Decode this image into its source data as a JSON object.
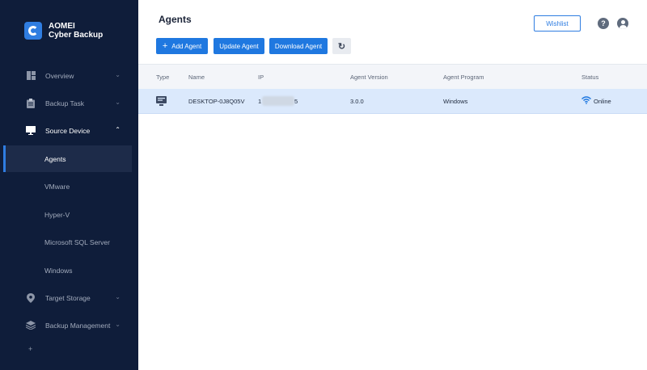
{
  "app": {
    "name_line1": "AOMEI",
    "name_line2": "Cyber Backup"
  },
  "sidebar": {
    "items": [
      {
        "label": "Overview",
        "icon": "overview-icon"
      },
      {
        "label": "Backup Task",
        "icon": "clipboard-icon"
      },
      {
        "label": "Source Device",
        "icon": "monitor-icon"
      },
      {
        "label": "Target Storage",
        "icon": "location-pin-icon"
      },
      {
        "label": "Backup Management",
        "icon": "layers-icon"
      }
    ],
    "sub_items": [
      {
        "label": "Agents"
      },
      {
        "label": "VMware"
      },
      {
        "label": "Hyper-V"
      },
      {
        "label": "Microsoft SQL Server"
      },
      {
        "label": "Windows"
      }
    ]
  },
  "header": {
    "title": "Agents",
    "wishlist_label": "Wishlist",
    "help_label": "?"
  },
  "toolbar": {
    "add_label": "Add Agent",
    "update_label": "Update Agent",
    "download_label": "Download Agent",
    "refresh_icon": "↻"
  },
  "table": {
    "columns": [
      "Type",
      "Name",
      "IP",
      "Agent Version",
      "Agent Program",
      "Status"
    ],
    "rows": [
      {
        "name": "DESKTOP-0J8Q05V",
        "ip_start": "1",
        "ip_end": "5",
        "version": "3.0.0",
        "program": "Windows",
        "status": "Online"
      }
    ]
  },
  "colors": {
    "accent": "#1f78e0",
    "sidebar_bg": "#0f1d3a",
    "row_selected": "#dbe9fc"
  }
}
